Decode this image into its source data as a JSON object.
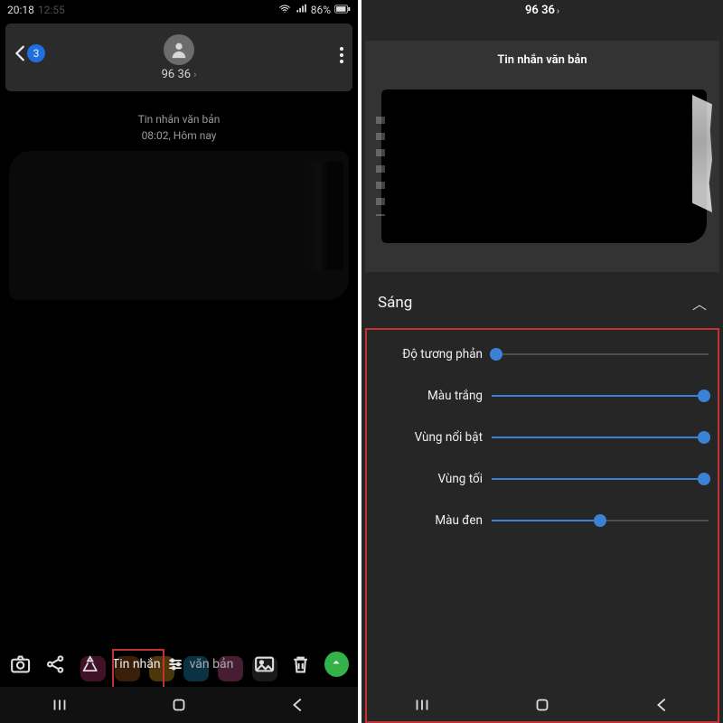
{
  "status": {
    "time1": "20:18",
    "time2": "12:55",
    "battery": "86%"
  },
  "chat": {
    "back_count": "3",
    "contact_name": "96 36",
    "message_type": "Tin nhắn văn bản",
    "timestamp": "08:02, Hôm nay"
  },
  "composer": {
    "placeholder_prefix": "Tin nhắn",
    "placeholder_suffix": "văn bản"
  },
  "editor": {
    "header_number": "96 36",
    "preview_caption": "Tin nhắn văn bản",
    "section_title": "Sáng",
    "sliders": [
      {
        "label": "Độ tương phản",
        "value": 2
      },
      {
        "label": "Màu trắng",
        "value": 98
      },
      {
        "label": "Vùng nổi bật",
        "value": 98
      },
      {
        "label": "Vùng tối",
        "value": 98
      },
      {
        "label": "Màu đen",
        "value": 50
      }
    ]
  }
}
